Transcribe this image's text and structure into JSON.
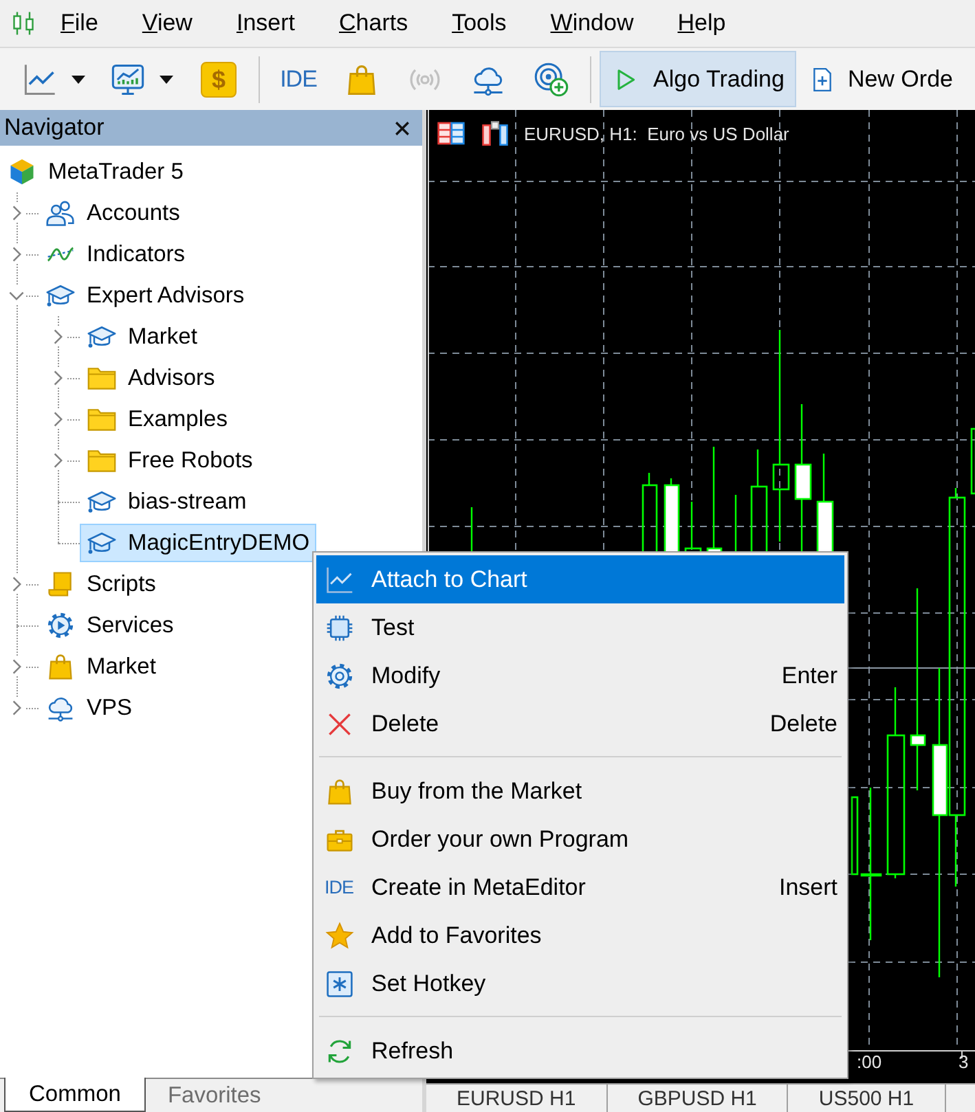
{
  "menu_bar": {
    "items": [
      "File",
      "View",
      "Insert",
      "Charts",
      "Tools",
      "Window",
      "Help"
    ]
  },
  "toolbar": {
    "groups": [
      [
        {
          "kind": "line-chart",
          "dropdown": true,
          "disabled": false
        },
        {
          "kind": "monitor-chart",
          "dropdown": true,
          "disabled": false
        },
        {
          "kind": "dollar",
          "text": "$",
          "dropdown": false,
          "disabled": false
        }
      ],
      [
        {
          "kind": "ide",
          "text": "IDE",
          "dropdown": false,
          "disabled": false
        },
        {
          "kind": "market",
          "dropdown": false,
          "disabled": false
        },
        {
          "kind": "signals",
          "dropdown": false,
          "disabled": true
        },
        {
          "kind": "vps",
          "dropdown": false,
          "disabled": false
        },
        {
          "kind": "target",
          "dropdown": false,
          "disabled": false
        }
      ]
    ],
    "buttons": [
      {
        "kind": "algo",
        "label": "Algo Trading",
        "pressed": true
      },
      {
        "kind": "order",
        "label": "New Orde",
        "pressed": false
      }
    ]
  },
  "navigator": {
    "title": "Navigator",
    "tree": [
      {
        "kind": "terminal",
        "label": "MetaTrader 5",
        "selected": false,
        "children": [
          {
            "kind": "accounts",
            "label": "Accounts",
            "expanded": false,
            "selected": false
          },
          {
            "kind": "indicators",
            "label": "Indicators",
            "expanded": false,
            "selected": false
          },
          {
            "kind": "expert",
            "label": "Expert Advisors",
            "expanded": true,
            "selected": false,
            "children": [
              {
                "kind": "expert",
                "label": "Market",
                "expanded": false,
                "selected": false
              },
              {
                "kind": "folder",
                "label": "Advisors",
                "expanded": false,
                "selected": false
              },
              {
                "kind": "folder",
                "label": "Examples",
                "expanded": false,
                "selected": false
              },
              {
                "kind": "folder",
                "label": "Free Robots",
                "expanded": false,
                "selected": false
              },
              {
                "kind": "expert",
                "label": "bias-stream",
                "selected": false
              },
              {
                "kind": "expert",
                "label": "MagicEntryDEMO",
                "selected": true
              }
            ]
          },
          {
            "kind": "scripts",
            "label": "Scripts",
            "expanded": false,
            "selected": false
          },
          {
            "kind": "services",
            "label": "Services",
            "selected": false
          },
          {
            "kind": "market",
            "label": "Market",
            "expanded": false,
            "selected": false
          },
          {
            "kind": "vps",
            "label": "VPS",
            "expanded": false,
            "selected": false
          }
        ]
      }
    ],
    "tabs": [
      {
        "label": "Common",
        "selected": true
      },
      {
        "label": "Favorites",
        "selected": false
      }
    ]
  },
  "chart": {
    "title": "EURUSD, H1:  Euro vs US Dollar",
    "time_labels": [
      ":00",
      "3"
    ],
    "tabs": [
      {
        "label": "EURUSD H1",
        "selected": false
      },
      {
        "label": "GBPUSD H1",
        "selected": false
      },
      {
        "label": "US500 H1",
        "selected": false
      }
    ]
  },
  "context_menu": {
    "groups": [
      [
        {
          "kind": "attach",
          "label": "Attach to Chart",
          "selected": true
        },
        {
          "kind": "test",
          "label": "Test",
          "selected": false
        },
        {
          "kind": "modify",
          "label": "Modify",
          "shortcut": "Enter",
          "selected": false
        },
        {
          "kind": "delete",
          "label": "Delete",
          "shortcut": "Delete",
          "selected": false
        }
      ],
      [
        {
          "kind": "buy",
          "label": "Buy from the Market",
          "selected": false
        },
        {
          "kind": "order",
          "label": "Order your own Program",
          "selected": false
        },
        {
          "kind": "create",
          "badge": "IDE",
          "label": "Create in MetaEditor",
          "shortcut": "Insert",
          "selected": false
        },
        {
          "kind": "favorite",
          "label": "Add to Favorites",
          "selected": false
        },
        {
          "kind": "hotkey",
          "label": "Set Hotkey",
          "selected": false
        }
      ],
      [
        {
          "kind": "refresh",
          "label": "Refresh",
          "selected": false
        }
      ]
    ]
  }
}
